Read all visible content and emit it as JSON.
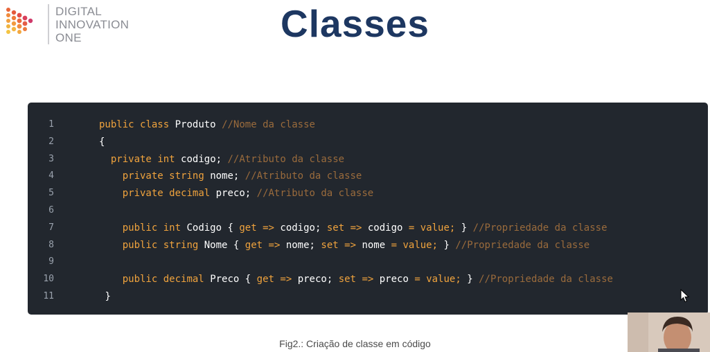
{
  "logo": {
    "line1": "DIGITAL",
    "line2": "INNOVATION",
    "line3": "ONE"
  },
  "slide": {
    "title": "Classes",
    "caption": "Fig2.: Criação de classe em código"
  },
  "code": {
    "line_numbers": [
      "1",
      "2",
      "3",
      "4",
      "5",
      "6",
      "7",
      "8",
      "9",
      "10",
      "11"
    ],
    "l1": {
      "public": "public",
      "class": "class",
      "name": "Produto",
      "comment": "//Nome da classe"
    },
    "l2": {
      "brace": "{"
    },
    "l3": {
      "private": "private",
      "type": "int",
      "name": "codigo;",
      "comment": "//Atributo da classe"
    },
    "l4": {
      "private": "private",
      "type": "string",
      "name": "nome;",
      "comment": "//Atributo da classe"
    },
    "l5": {
      "private": "private",
      "type": "decimal",
      "name": "preco;",
      "comment": "//Atributo da classe"
    },
    "l7": {
      "public": "public",
      "type": "int",
      "name": "Codigo",
      "open": "{",
      "get": "get",
      "arrow1": "=>",
      "val1": "codigo;",
      "set": "set",
      "arrow2": "=>",
      "val2": "codigo",
      "eq": "=",
      "value": "value;",
      "close": "}",
      "comment": "//Propriedade da classe"
    },
    "l8": {
      "public": "public",
      "type": "string",
      "name": "Nome",
      "open": "{",
      "get": "get",
      "arrow1": "=>",
      "val1": "nome;",
      "set": "set",
      "arrow2": "=>",
      "val2": "nome",
      "eq": "=",
      "value": "value;",
      "close": "}",
      "comment": "//Propriedade da classe"
    },
    "l10": {
      "public": "public",
      "type": "decimal",
      "name": "Preco",
      "open": "{",
      "get": "get",
      "arrow1": "=>",
      "val1": "preco;",
      "set": "set",
      "arrow2": "=>",
      "val2": "preco",
      "eq": "=",
      "value": "value;",
      "close": "}",
      "comment": "//Propriedade da classe"
    },
    "l11": {
      "brace": "}"
    }
  },
  "colors": {
    "title": "#1d3761",
    "panel_bg": "#22272e",
    "keyword": "#f0a33d",
    "comment": "#9a6b3c"
  },
  "icons": {
    "logo_mark": "dio-logo-icon",
    "cursor": "mouse-pointer-icon",
    "webcam": "presenter-webcam"
  }
}
